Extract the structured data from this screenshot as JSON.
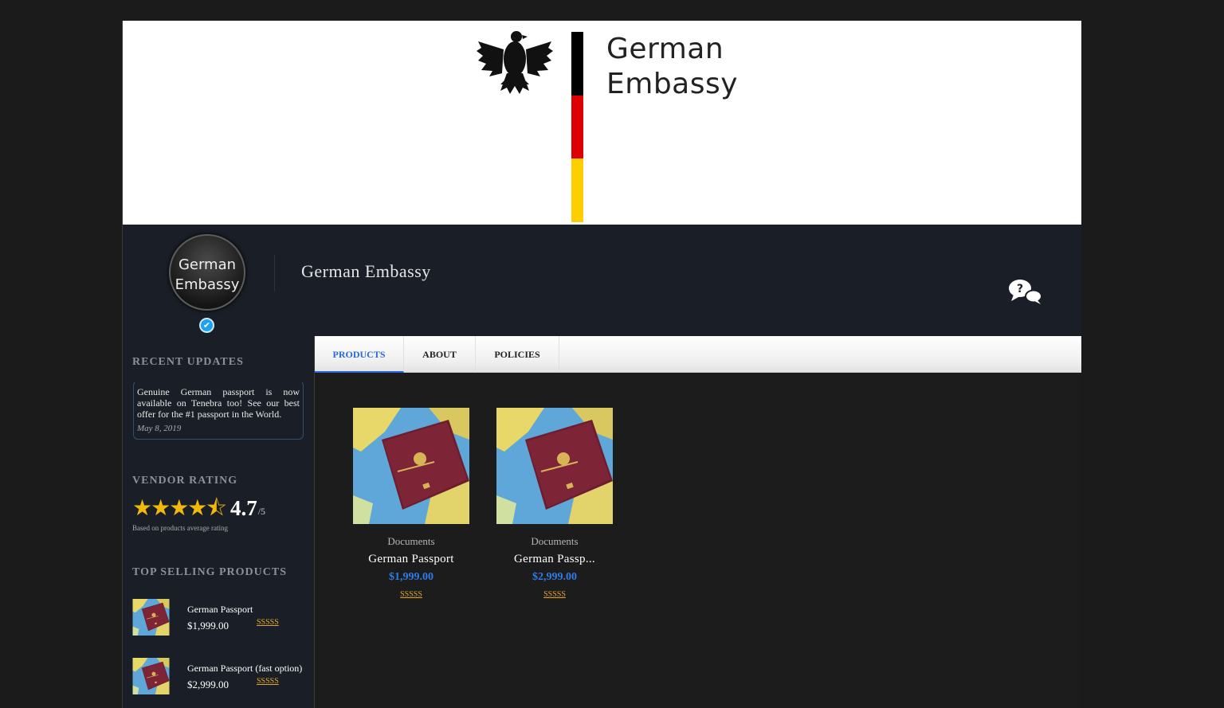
{
  "banner": {
    "line1": "German",
    "line2": "Embassy"
  },
  "vendor": {
    "avatar_line1": "German",
    "avatar_line2": "Embassy",
    "name": "German Embassy"
  },
  "sidebar": {
    "recent_updates": {
      "heading": "RECENT UPDATES",
      "text": "Genuine German passport is now available on Tenebra too! See our best offer for the #1 passport in the World.",
      "date": "May 8, 2019"
    },
    "vendor_rating": {
      "heading": "VENDOR RATING",
      "value": "4.7",
      "max": "/5",
      "stars_value": 4.7,
      "note": "Based on products average rating"
    },
    "top_selling": {
      "heading": "TOP SELLING PRODUCTS",
      "items": [
        {
          "name": "German Passport",
          "price": "$1,999.00",
          "stars": "SSSSS"
        },
        {
          "name": "German Passport (fast option)",
          "price": "$2,999.00",
          "stars": "SSSSS"
        }
      ]
    }
  },
  "tabs": [
    {
      "label": "PRODUCTS",
      "active": true
    },
    {
      "label": "ABOUT",
      "active": false
    },
    {
      "label": "POLICIES",
      "active": false
    }
  ],
  "products": [
    {
      "category": "Documents",
      "name": "German Passport",
      "price": "$1,999.00",
      "stars": "SSSSS"
    },
    {
      "category": "Documents",
      "name": "German Passp...",
      "price": "$2,999.00",
      "stars": "SSSSS"
    }
  ],
  "icons": {
    "eagle": "eagle-icon",
    "chat": "chat-bubbles-icon",
    "verified": "verified-check-icon",
    "passport": "passport-image"
  },
  "colors": {
    "flag_black": "#000000",
    "flag_red": "#dd0000",
    "flag_gold": "#ffce00",
    "star": "#f0b90b",
    "price": "#2f7be8",
    "active_tab": "#2a6ad8"
  }
}
